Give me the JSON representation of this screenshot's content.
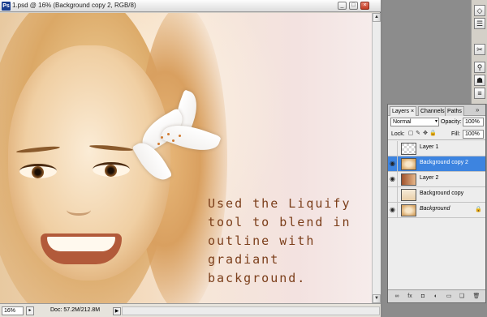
{
  "document": {
    "title": "1.psd @ 16% (Background copy 2, RGB/8)",
    "app_icon_letter": "Ps",
    "window_buttons": {
      "minimize": "_",
      "maximize": "□",
      "close": "×"
    },
    "caption": "Used the Liquify\ntool to blend in\noutline with\ngradiant\nbackground.",
    "scroll_up": "▲",
    "scroll_down": "▼"
  },
  "status_bar": {
    "zoom": "16%",
    "zoom_button": "▸",
    "doc_size": "Doc: 57.2M/212.8M",
    "menu_arrow": "▶"
  },
  "tools": [
    "◇",
    "☰",
    "✂",
    "⚲",
    "☗",
    "≡",
    "▤"
  ],
  "layers_panel": {
    "tabs": [
      "Layers ×",
      "Channels",
      "Paths"
    ],
    "menu": "»",
    "blend_mode": "Normal",
    "blend_dropdown": "▾",
    "opacity_label": "Opacity:",
    "opacity_value": "100%",
    "lock_label": "Lock:",
    "lock_icons": [
      "▢",
      "✎",
      "✥",
      "🔒"
    ],
    "fill_label": "Fill:",
    "fill_value": "100%",
    "layers": [
      {
        "name": "Layer 1",
        "visible": false,
        "selected": false,
        "italic": false,
        "locked": false,
        "thumb": "check"
      },
      {
        "name": "Background copy 2",
        "visible": true,
        "selected": true,
        "italic": false,
        "locked": false,
        "thumb": "face"
      },
      {
        "name": "Layer 2",
        "visible": true,
        "selected": false,
        "italic": false,
        "locked": false,
        "thumb": "brown"
      },
      {
        "name": "Background copy",
        "visible": false,
        "selected": false,
        "italic": false,
        "locked": false,
        "thumb": "light"
      },
      {
        "name": "Background",
        "visible": true,
        "selected": false,
        "italic": true,
        "locked": true,
        "thumb": "face"
      }
    ],
    "eye_glyph": "◉",
    "lock_glyph": "🔒",
    "footer_icons": [
      "∞",
      "fx",
      "◘",
      "◐",
      "▭",
      "❏",
      "🗑"
    ]
  },
  "colors": {
    "selection": "#3d84e0",
    "caption_text": "#7b3e1a"
  }
}
